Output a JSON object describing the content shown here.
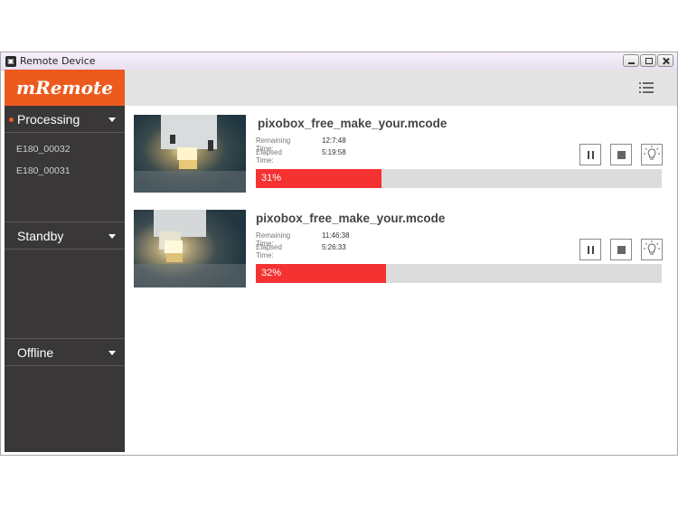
{
  "window": {
    "title": "Remote Device"
  },
  "sidebar": {
    "logo": "mRemote",
    "sections": [
      {
        "label": "Processing",
        "active": true,
        "items": [
          "E180_00032",
          "E180_00031"
        ]
      },
      {
        "label": "Standby",
        "active": false,
        "items": []
      },
      {
        "label": "Offline",
        "active": false,
        "items": []
      }
    ]
  },
  "toolbar": {
    "menu_icon": "list-menu-icon"
  },
  "jobs": [
    {
      "name": "pixobox_free_make_your.mcode",
      "remaining_label": "Remaining Time:",
      "remaining_value": "12:7:48",
      "elapsed_label": "Elapsed Time:",
      "elapsed_value": "5:19:58",
      "progress": 31,
      "progress_label": "31%"
    },
    {
      "name": "pixobox_free_make_your.mcode",
      "remaining_label": "Remaining Time:",
      "remaining_value": "11:46:38",
      "elapsed_label": "Elapsed Time:",
      "elapsed_value": "5:26:33",
      "progress": 32,
      "progress_label": "32%"
    }
  ],
  "colors": {
    "accent": "#ec5a1e",
    "sidebar_bg": "#393737",
    "progress_fill": "#f53232",
    "progress_track": "#dcdcdc"
  }
}
